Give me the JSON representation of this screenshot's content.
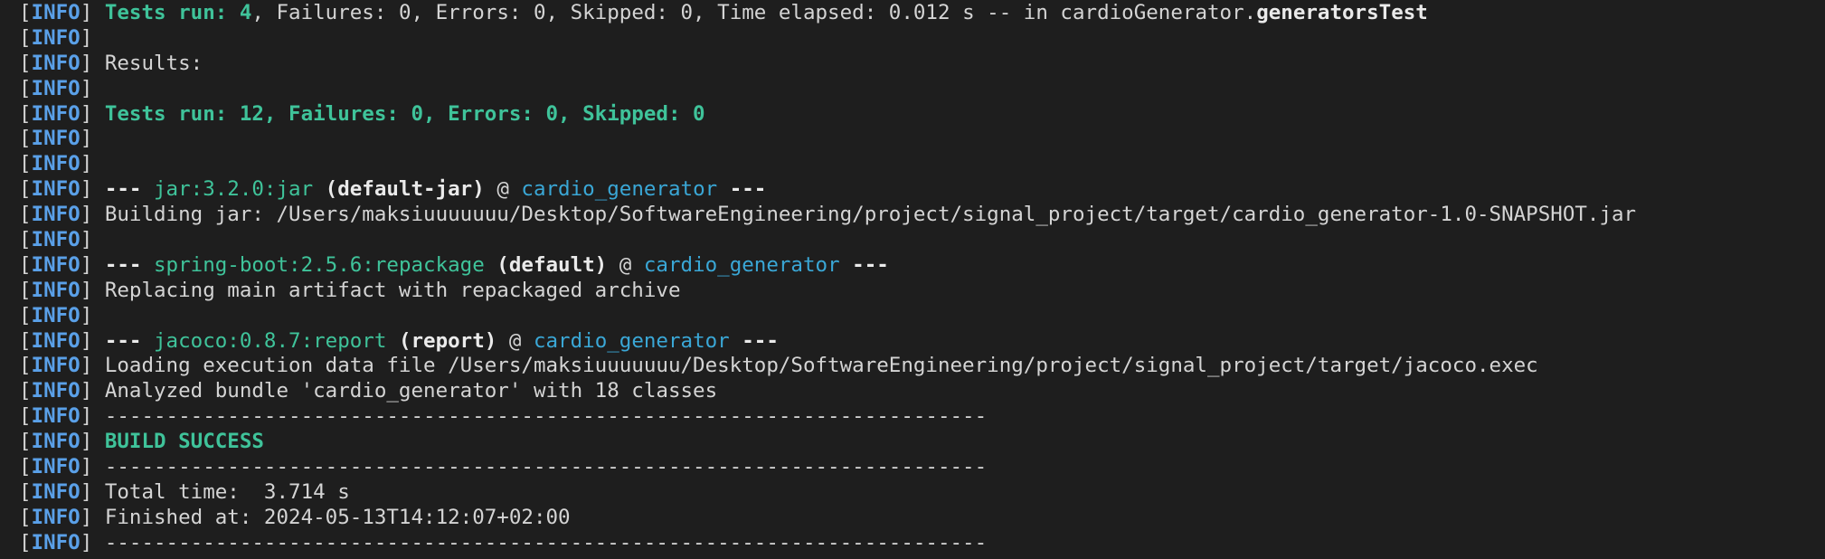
{
  "colors": {
    "background": "#1e1e1e",
    "text": "#d4d4d4",
    "info_tag": "#5aa0e8",
    "green": "#3fc39a",
    "cyan": "#3aa7d6"
  },
  "lines": [
    {
      "name": "tests-run-generators-line",
      "segments": [
        {
          "text": "Tests run: 4",
          "style": "gb"
        },
        {
          "text": ", Failures: 0, Errors: 0, Skipped: 0, Time elapsed: 0.012 s -- in cardioGenerator.",
          "style": "w"
        },
        {
          "text": "generatorsTest",
          "style": "wb"
        }
      ]
    },
    {
      "name": "blank-line",
      "segments": []
    },
    {
      "name": "results-heading-line",
      "segments": [
        {
          "text": "Results:",
          "style": "w"
        }
      ]
    },
    {
      "name": "blank-line",
      "segments": []
    },
    {
      "name": "tests-run-summary-line",
      "segments": [
        {
          "text": "Tests run: 12, Failures: 0, Errors: 0, Skipped: 0",
          "style": "gb"
        }
      ]
    },
    {
      "name": "blank-line",
      "segments": []
    },
    {
      "name": "blank-line",
      "segments": []
    },
    {
      "name": "jar-plugin-header-line",
      "segments": [
        {
          "text": "--- ",
          "style": "wb"
        },
        {
          "text": "jar:3.2.0:jar",
          "style": "g"
        },
        {
          "text": " (default-jar)",
          "style": "wb"
        },
        {
          "text": " @ ",
          "style": "w"
        },
        {
          "text": "cardio_generator",
          "style": "c"
        },
        {
          "text": " ---",
          "style": "wb"
        }
      ]
    },
    {
      "name": "building-jar-line",
      "segments": [
        {
          "text": "Building jar: /Users/maksiuuuuuuu/Desktop/SoftwareEngineering/project/signal_project/target/cardio_generator-1.0-SNAPSHOT.jar",
          "style": "w"
        }
      ]
    },
    {
      "name": "blank-line",
      "segments": []
    },
    {
      "name": "spring-boot-plugin-header-line",
      "segments": [
        {
          "text": "--- ",
          "style": "wb"
        },
        {
          "text": "spring-boot:2.5.6:repackage",
          "style": "g"
        },
        {
          "text": " (default)",
          "style": "wb"
        },
        {
          "text": " @ ",
          "style": "w"
        },
        {
          "text": "cardio_generator",
          "style": "c"
        },
        {
          "text": " ---",
          "style": "wb"
        }
      ]
    },
    {
      "name": "replacing-artifact-line",
      "segments": [
        {
          "text": "Replacing main artifact with repackaged archive",
          "style": "w"
        }
      ]
    },
    {
      "name": "blank-line",
      "segments": []
    },
    {
      "name": "jacoco-plugin-header-line",
      "segments": [
        {
          "text": "--- ",
          "style": "wb"
        },
        {
          "text": "jacoco:0.8.7:report",
          "style": "g"
        },
        {
          "text": " (report)",
          "style": "wb"
        },
        {
          "text": " @ ",
          "style": "w"
        },
        {
          "text": "cardio_generator",
          "style": "c"
        },
        {
          "text": " ---",
          "style": "wb"
        }
      ]
    },
    {
      "name": "loading-execution-data-line",
      "segments": [
        {
          "text": "Loading execution data file /Users/maksiuuuuuuu/Desktop/SoftwareEngineering/project/signal_project/target/jacoco.exec",
          "style": "w"
        }
      ]
    },
    {
      "name": "analyzed-bundle-line",
      "segments": [
        {
          "text": "Analyzed bundle 'cardio_generator' with 18 classes",
          "style": "w"
        }
      ]
    },
    {
      "name": "separator-line",
      "segments": [
        {
          "text": "------------------------------------------------------------------------",
          "style": "w"
        }
      ]
    },
    {
      "name": "build-success-line",
      "segments": [
        {
          "text": "BUILD SUCCESS",
          "style": "gb"
        }
      ]
    },
    {
      "name": "separator-line",
      "segments": [
        {
          "text": "------------------------------------------------------------------------",
          "style": "w"
        }
      ]
    },
    {
      "name": "total-time-line",
      "segments": [
        {
          "text": "Total time:  3.714 s",
          "style": "w"
        }
      ]
    },
    {
      "name": "finished-at-line",
      "segments": [
        {
          "text": "Finished at: 2024-05-13T14:12:07+02:00",
          "style": "w"
        }
      ]
    },
    {
      "name": "separator-line",
      "segments": [
        {
          "text": "------------------------------------------------------------------------",
          "style": "w"
        }
      ]
    }
  ],
  "prefix": {
    "open": "[",
    "tag": "INFO",
    "close": "]"
  }
}
